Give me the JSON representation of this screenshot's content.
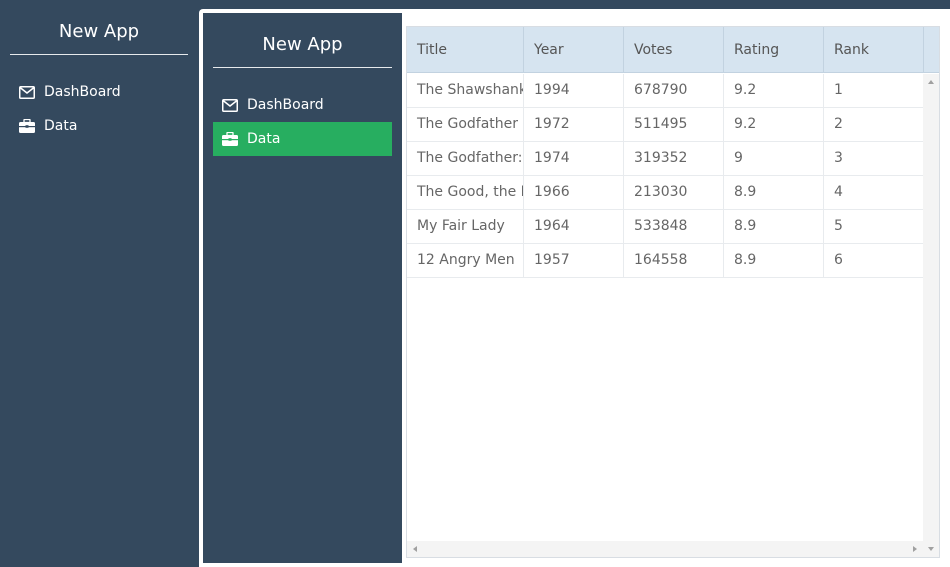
{
  "back": {
    "app_title": "New App",
    "nav": [
      {
        "label": "DashBoard",
        "icon": "envelope-icon"
      },
      {
        "label": "Data",
        "icon": "briefcase-icon"
      }
    ]
  },
  "front": {
    "app_title": "New App",
    "nav": [
      {
        "label": "DashBoard",
        "icon": "envelope-icon"
      },
      {
        "label": "Data",
        "icon": "briefcase-icon",
        "active": true
      }
    ]
  },
  "grid": {
    "columns": [
      "Title",
      "Year",
      "Votes",
      "Rating",
      "Rank"
    ],
    "rows": [
      [
        "The Shawshank Redemption",
        "1994",
        "678790",
        "9.2",
        "1"
      ],
      [
        "The Godfather",
        "1972",
        "511495",
        "9.2",
        "2"
      ],
      [
        "The Godfather: Part II",
        "1974",
        "319352",
        "9",
        "3"
      ],
      [
        "The Good, the Bad and the Ugly",
        "1966",
        "213030",
        "8.9",
        "4"
      ],
      [
        "My Fair Lady",
        "1964",
        "533848",
        "8.9",
        "5"
      ],
      [
        "12 Angry Men",
        "1957",
        "164558",
        "8.9",
        "6"
      ]
    ]
  },
  "colors": {
    "sidebar": "#34495e",
    "active": "#27ae60",
    "header": "#d6e4f0"
  }
}
